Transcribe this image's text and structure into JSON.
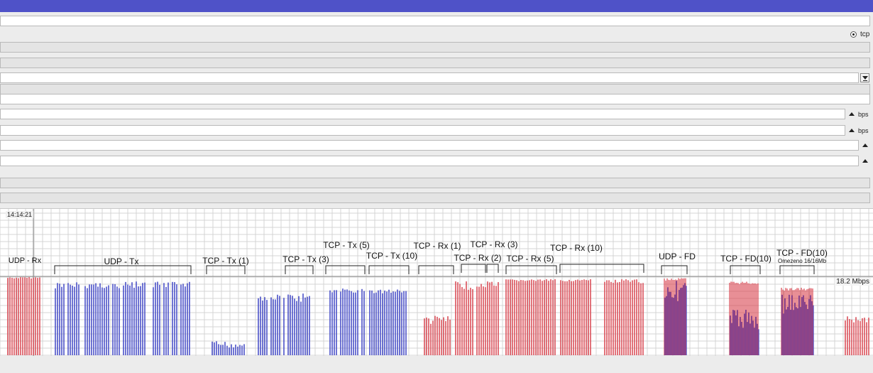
{
  "window": {
    "title_color": "#4f52c8"
  },
  "form": {
    "protocol_radio_label": "tcp",
    "rate_unit_1": "bps",
    "rate_unit_2": "bps",
    "dropdown_icon": "chevron-down-icon",
    "spinner_icon": "triangle-up-icon"
  },
  "graph": {
    "time_label": "14:14:21",
    "scale_label": "18.2 Mbps",
    "colors": {
      "rx": "#d9444f",
      "tx": "#3f46c4",
      "grid": "#d4d4d4",
      "midline": "#888888"
    },
    "annotations": [
      {
        "text": "UDP - Rx"
      },
      {
        "text": "UDP - Tx"
      },
      {
        "text": "TCP - Tx (1)"
      },
      {
        "text": "TCP - Tx (3)"
      },
      {
        "text": "TCP - Tx (5)"
      },
      {
        "text": "TCP - Tx (10)"
      },
      {
        "text": "TCP - Rx (1)"
      },
      {
        "text": "TCP - Rx (3)"
      },
      {
        "text": "TCP - Rx (2)"
      },
      {
        "text": "TCP - Rx (5)"
      },
      {
        "text": "TCP - Rx (10)"
      },
      {
        "text": "UDP - FD"
      },
      {
        "text": "TCP - FD(10)"
      },
      {
        "text": "TCP - FD(10)"
      }
    ],
    "note": "Omezeno 16/16Mb"
  }
}
